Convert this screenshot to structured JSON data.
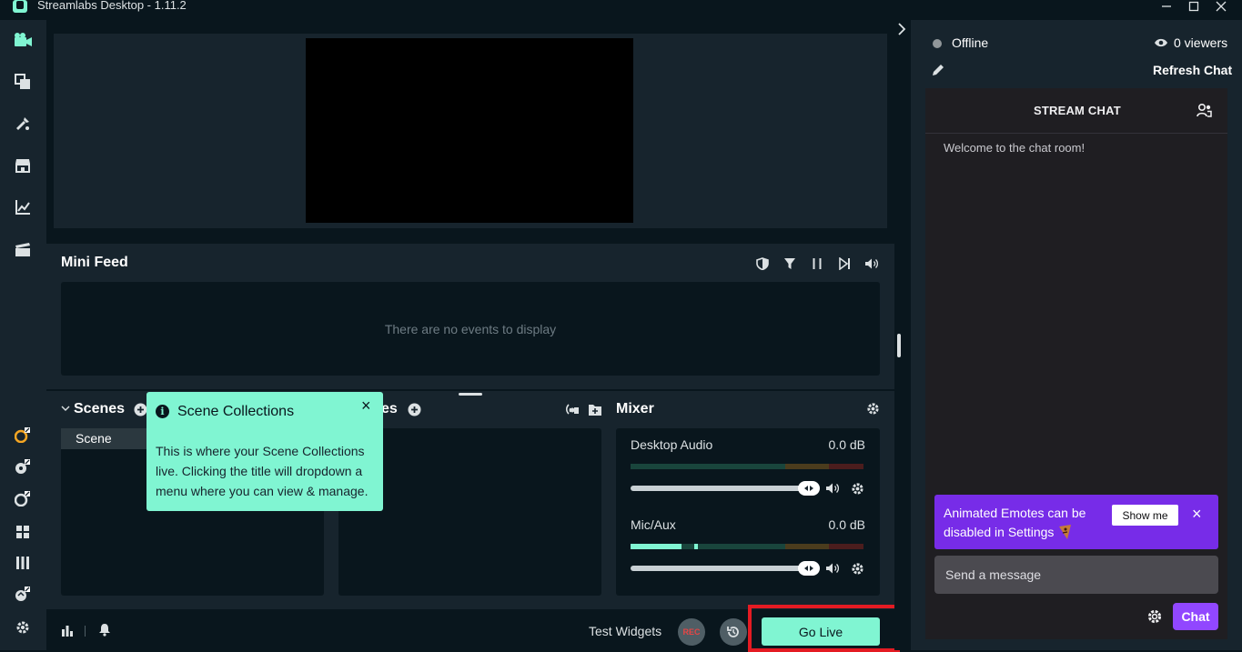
{
  "window": {
    "title": "Streamlabs Desktop - 1.11.2",
    "minimize_icon": "minimize-icon",
    "maximize_icon": "maximize-icon",
    "close_icon": "close-icon"
  },
  "left_nav": {
    "items": [
      "editor-camera-icon",
      "themes-icon",
      "tools-icon",
      "store-icon",
      "dashboard-chart-icon",
      "recordings-clapper-icon"
    ],
    "bottom_items": [
      "external-link-icon",
      "external-link-icon",
      "external-link-icon",
      "layout-icon",
      "studio-mode-icon",
      "external-link-icon",
      "settings-gear-icon"
    ]
  },
  "mini_feed": {
    "title": "Mini Feed",
    "empty_text": "There are no events to display",
    "controls": [
      "shield-icon",
      "filter-icon",
      "pause-icon",
      "skip-icon",
      "volume-icon"
    ]
  },
  "scenes": {
    "title": "Scenes",
    "items": [
      "Scene"
    ]
  },
  "sources": {
    "title_fragment": "es"
  },
  "mixer": {
    "title": "Mixer",
    "channels": [
      {
        "name": "Desktop Audio",
        "db": "0.0 dB",
        "level": 0.0,
        "volume": 1.0
      },
      {
        "name": "Mic/Aux",
        "db": "0.0 dB",
        "level": 0.22,
        "volume": 1.0
      }
    ]
  },
  "tooltip": {
    "title": "Scene Collections",
    "body": "This is where your Scene Collections live. Clicking the title will dropdown a menu where you can view & manage.",
    "close": "×"
  },
  "footer": {
    "test_widgets": "Test Widgets",
    "rec": "REC",
    "go_live": "Go Live"
  },
  "chat_panel": {
    "status": "Offline",
    "viewers": "0 viewers",
    "refresh": "Refresh Chat",
    "title": "STREAM CHAT",
    "welcome": "Welcome to the chat room!",
    "notice": "Animated Emotes can be disabled in Settings",
    "notice_button": "Show me",
    "notice_close": "×",
    "input_placeholder": "Send a message",
    "send_button": "Chat"
  },
  "colors": {
    "accent": "#80f5d2",
    "twitch_purple": "#9147ff",
    "highlight_red": "#e41b23"
  }
}
